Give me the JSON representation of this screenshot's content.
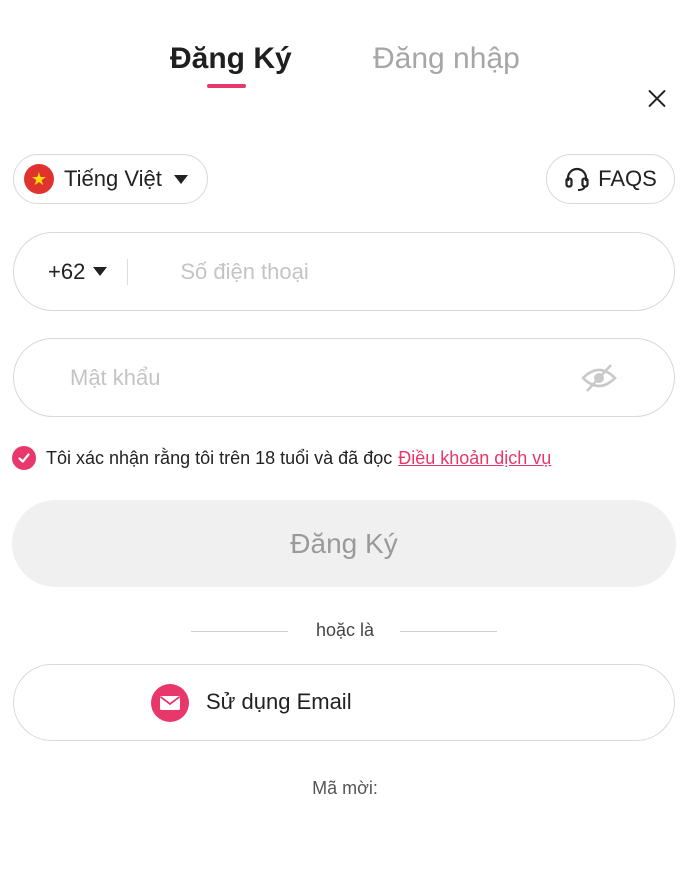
{
  "tabs": {
    "register": "Đăng Ký",
    "login": "Đăng nhập",
    "active": "register"
  },
  "language": {
    "label": "Tiếng Việt",
    "flag": "vn-flag-icon"
  },
  "faq": {
    "label": "FAQS",
    "icon": "headset-icon"
  },
  "phone": {
    "dial_code": "+62",
    "placeholder": "Số điện thoại"
  },
  "password": {
    "placeholder": "Mật khẩu",
    "icon": "eye-off-icon"
  },
  "agreement": {
    "text": "Tôi xác nhận rằng tôi trên 18 tuổi và đã đọc",
    "link": "Điều khoản dịch vụ",
    "checked": true
  },
  "submit_label": "Đăng Ký",
  "divider_text": "hoặc là",
  "email_button": {
    "label": "Sử dụng Email",
    "icon": "mail-icon"
  },
  "invite_label": "Mã mời:",
  "colors": {
    "accent": "#e8376a",
    "border": "#d8d8d8",
    "muted": "#a6a6a6",
    "button_disabled_bg": "#f0f0f0"
  }
}
